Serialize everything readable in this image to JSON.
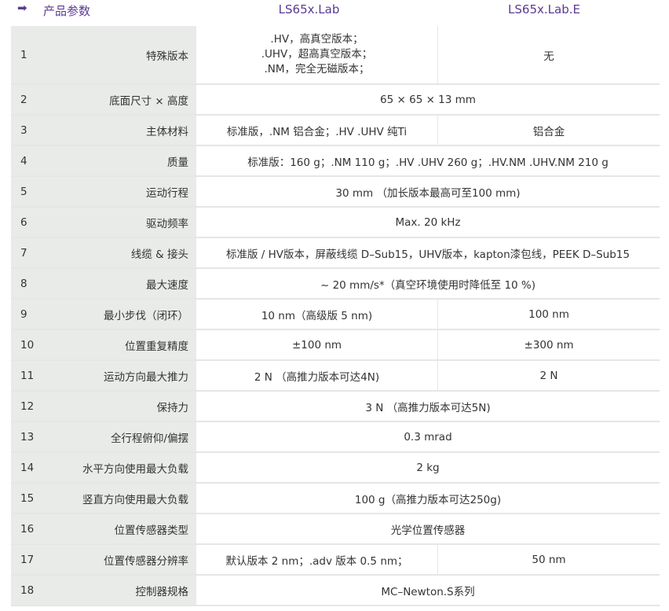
{
  "header": {
    "arrow": "➡",
    "param": "产品参数",
    "col1": "LS65x.Lab",
    "col2": "LS65x.Lab.E"
  },
  "rows": [
    {
      "num": "1",
      "label": "特殊版本",
      "v1": [
        ".HV，高真空版本；",
        ".UHV，超高真空版本；",
        ".NM，完全无磁版本；"
      ],
      "v2": "无"
    },
    {
      "num": "2",
      "label": "底面尺寸 × 高度",
      "v": "65 × 65 × 13 mm"
    },
    {
      "num": "3",
      "label": "主体材料",
      "v1": "标准版，.NM 铝合金；.HV .UHV 纯Ti",
      "v2": "铝合金"
    },
    {
      "num": "4",
      "label": "质量",
      "v": "标准版：160 g；.NM 110 g；.HV .UHV 260 g；.HV.NM .UHV.NM 210 g"
    },
    {
      "num": "5",
      "label": "运动行程",
      "v": "30 mm （加长版本最高可至100 mm)"
    },
    {
      "num": "6",
      "label": "驱动频率",
      "v": "Max. 20 kHz"
    },
    {
      "num": "7",
      "label": "线缆 & 接头",
      "v": "标准版 / HV版本，屏蔽线缆 D–Sub15，UHV版本，kapton漆包线，PEEK D–Sub15"
    },
    {
      "num": "8",
      "label": "最大速度",
      "v": "~ 20 mm/s*（真空环境使用时降低至 10 %)"
    },
    {
      "num": "9",
      "label": "最小步伐（闭环）",
      "v1": "10 nm（高级版 5 nm)",
      "v2": "100 nm"
    },
    {
      "num": "10",
      "label": "位置重复精度",
      "v1": "±100 nm",
      "v2": "±300 nm"
    },
    {
      "num": "11",
      "label": "运动方向最大推力",
      "v1": "2 N （高推力版本可达4N)",
      "v2": "2 N"
    },
    {
      "num": "12",
      "label": "保持力",
      "v": "3 N （高推力版本可达5N)"
    },
    {
      "num": "13",
      "label": "全行程俯仰/偏摆",
      "v": "0.3 mrad"
    },
    {
      "num": "14",
      "label": "水平方向使用最大负载",
      "v": "2 kg"
    },
    {
      "num": "15",
      "label": "竖直方向使用最大负载",
      "v": "100 g（高推力版本可达250g)"
    },
    {
      "num": "16",
      "label": "位置传感器类型",
      "v": "光学位置传感器"
    },
    {
      "num": "17",
      "label": "位置传感器分辨率",
      "v1": "默认版本  2 nm；.adv 版本  0.5 nm；",
      "v2": "50 nm"
    },
    {
      "num": "18",
      "label": "控制器规格",
      "v": "MC–Newton.S系列"
    }
  ]
}
